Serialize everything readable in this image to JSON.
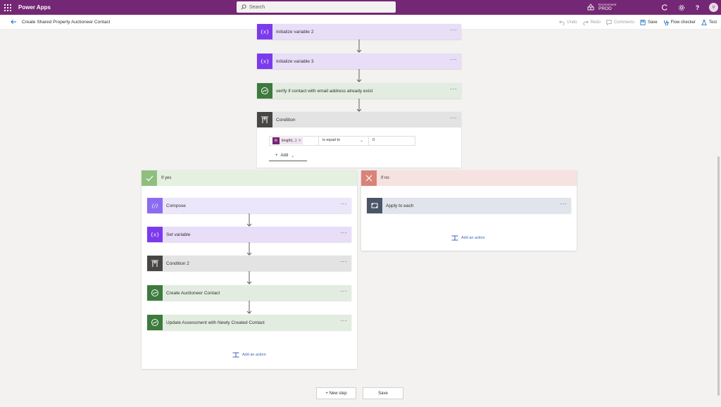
{
  "app": {
    "name": "Power Apps"
  },
  "search": {
    "placeholder": "Search"
  },
  "environment": {
    "label": "Environment",
    "name": "PROD"
  },
  "user": {
    "initial": "V"
  },
  "flow": {
    "title": "Create Shared Property Auctioneer Contact"
  },
  "commands": {
    "undo": "Undo",
    "redo": "Redo",
    "comments": "Comments",
    "save": "Save",
    "flow_checker": "Flow checker",
    "test": "Test"
  },
  "steps": {
    "init_var_2": "Initialize variable 2",
    "init_var_3": "Initialize variable 3",
    "verify_contact": "verify if contact with email address already exist",
    "condition": "Condition"
  },
  "condition": {
    "token": "length(...)",
    "token_remove": "×",
    "operator": "is equal to",
    "operand": "0",
    "add_label": "Add"
  },
  "if_yes": {
    "label": "If yes",
    "steps": [
      "Compose",
      "Set variable",
      "Condition 2",
      "Create Auctioneer Contact",
      "Update Assessment with Newly Created Contact"
    ],
    "add_action": "Add an action"
  },
  "if_no": {
    "label": "If no",
    "steps": [
      "Apply to each"
    ],
    "add_action": "Add an action"
  },
  "bottom": {
    "new_step": "+ New step",
    "save": "Save"
  },
  "more_glyph": "···"
}
